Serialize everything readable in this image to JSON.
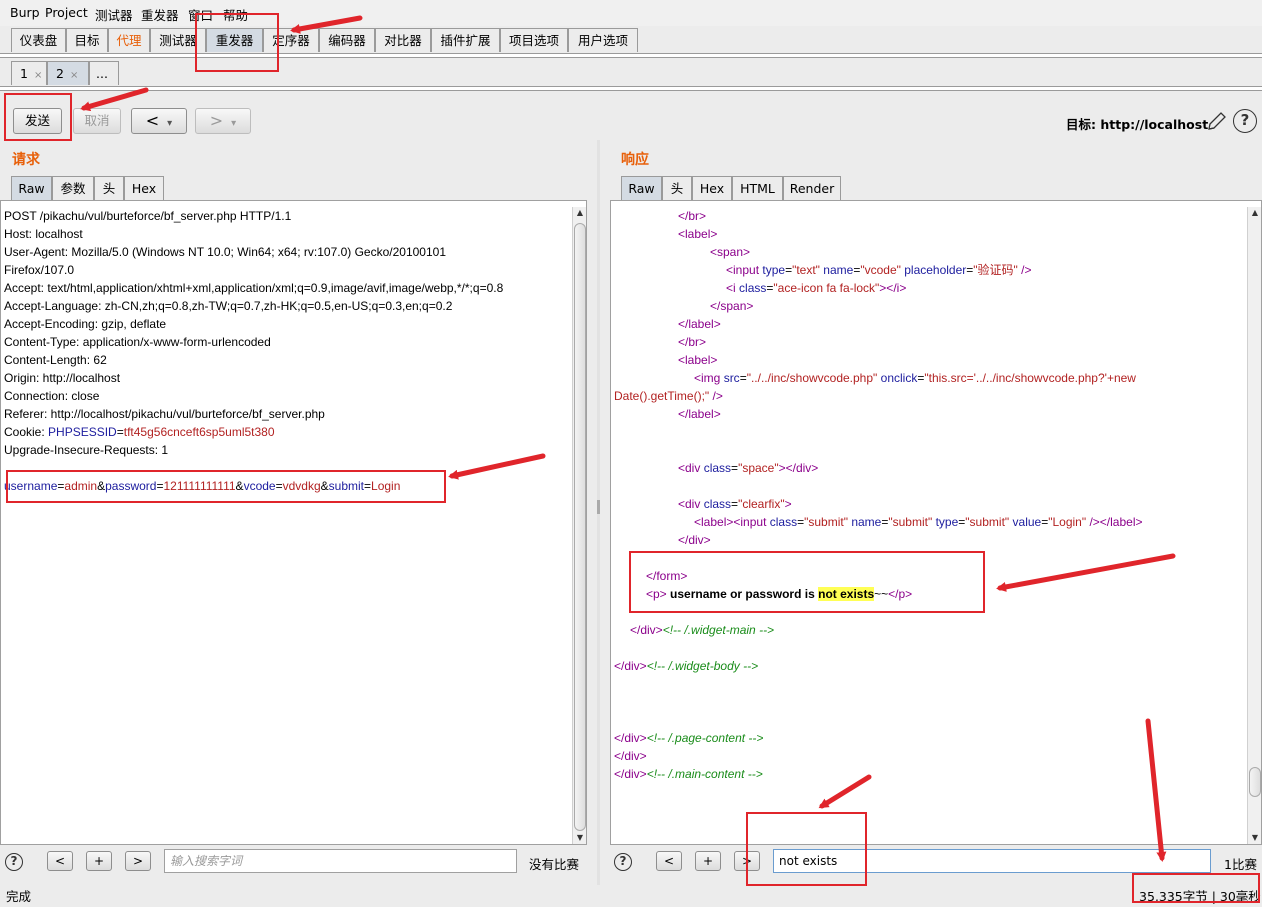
{
  "menu": [
    "Burp",
    "Project",
    "测试器",
    "重发器",
    "窗口",
    "帮助"
  ],
  "main_tabs": [
    "仪表盘",
    "目标",
    "代理",
    "测试器",
    "重发器",
    "定序器",
    "编码器",
    "对比器",
    "插件扩展",
    "项目选项",
    "用户选项"
  ],
  "sub_tabs": [
    {
      "label": "1",
      "close": "×"
    },
    {
      "label": "2",
      "close": "×"
    },
    {
      "label": "..."
    }
  ],
  "toolbar": {
    "send": "发送",
    "cancel": "取消",
    "back": "<",
    "forward": ">",
    "dropdown": "▾",
    "target_label": "目标: http://localhost"
  },
  "request": {
    "title": "请求",
    "tabs": [
      "Raw",
      "参数",
      "头",
      "Hex"
    ],
    "lines": [
      "POST /pikachu/vul/burteforce/bf_server.php HTTP/1.1",
      "Host: localhost",
      "User-Agent: Mozilla/5.0 (Windows NT 10.0; Win64; x64; rv:107.0) Gecko/20100101",
      "Firefox/107.0",
      "Accept: text/html,application/xhtml+xml,application/xml;q=0.9,image/avif,image/webp,*/*;q=0.8",
      "Accept-Language: zh-CN,zh;q=0.8,zh-TW;q=0.7,zh-HK;q=0.5,en-US;q=0.3,en;q=0.2",
      "Accept-Encoding: gzip, deflate",
      "Content-Type: application/x-www-form-urlencoded",
      "Content-Length: 62",
      "Origin: http://localhost",
      "Connection: close",
      "Referer: http://localhost/pikachu/vul/burteforce/bf_server.php"
    ],
    "cookie_label": "Cookie: ",
    "cookie_name": "PHPSESSID",
    "cookie_value": "tft45g56cnceft6sp5uml5t380",
    "upgrade_line": "Upgrade-Insecure-Requests: 1",
    "body": {
      "k1": "username",
      "v1": "admin",
      "k2": "password",
      "v2": "121111111111",
      "k3": "vcode",
      "v3": "vdvdkg",
      "k4": "submit",
      "v4": "Login"
    },
    "search_placeholder": "输入搜索字词",
    "match_status": "没有比赛"
  },
  "response": {
    "title": "响应",
    "tabs": [
      "Raw",
      "头",
      "Hex",
      "HTML",
      "Render"
    ],
    "message_text": "username or password is ",
    "message_highlight": "not exists",
    "message_tail": "~~",
    "search_value": "not exists",
    "match_status": "1比赛"
  },
  "status": {
    "left": "完成",
    "right": "35,335字节 | 30毫秒"
  }
}
